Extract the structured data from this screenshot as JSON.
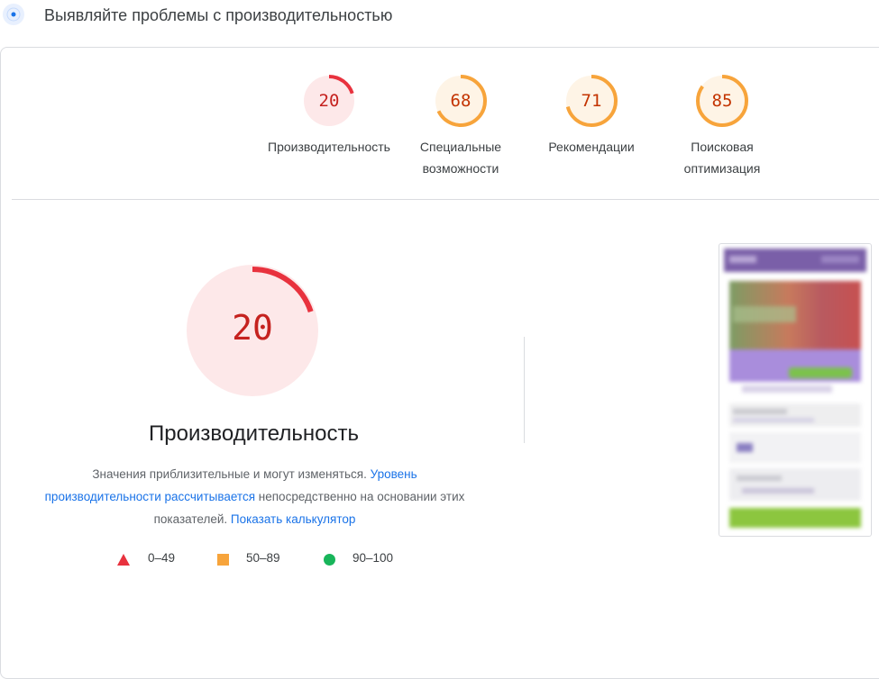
{
  "header": {
    "title": "Выявляйте проблемы с производительностью",
    "icon": "radar-icon"
  },
  "gauges": [
    {
      "score": "20",
      "label": "Производительность",
      "color": "#e8323e",
      "fraction": 0.2
    },
    {
      "score": "68",
      "label": "Специальные возможности",
      "color": "#f7a43b",
      "fraction": 0.68
    },
    {
      "score": "71",
      "label": "Рекомендации",
      "color": "#f7a43b",
      "fraction": 0.71
    },
    {
      "score": "85",
      "label": "Поисковая оптимизация",
      "color": "#f7a43b",
      "fraction": 0.85
    }
  ],
  "main": {
    "score": "20",
    "fraction": 0.2,
    "title": "Производительность",
    "desc_part1": "Значения приблизительные и могут изменяться. ",
    "desc_link1": "Уровень производительности рассчитывается",
    "desc_part2": " непосредственно на основании этих показателей. ",
    "desc_link2": "Показать калькулятор"
  },
  "legend": [
    {
      "shape": "triangle",
      "range": "0–49",
      "color": "#e8323e"
    },
    {
      "shape": "square",
      "range": "50–89",
      "color": "#f7a43b"
    },
    {
      "shape": "circle",
      "range": "90–100",
      "color": "#18b55a"
    }
  ],
  "colors": {
    "fail": "#e8323e",
    "average": "#f7a43b",
    "pass": "#18b55a",
    "link": "#1a73e8"
  }
}
